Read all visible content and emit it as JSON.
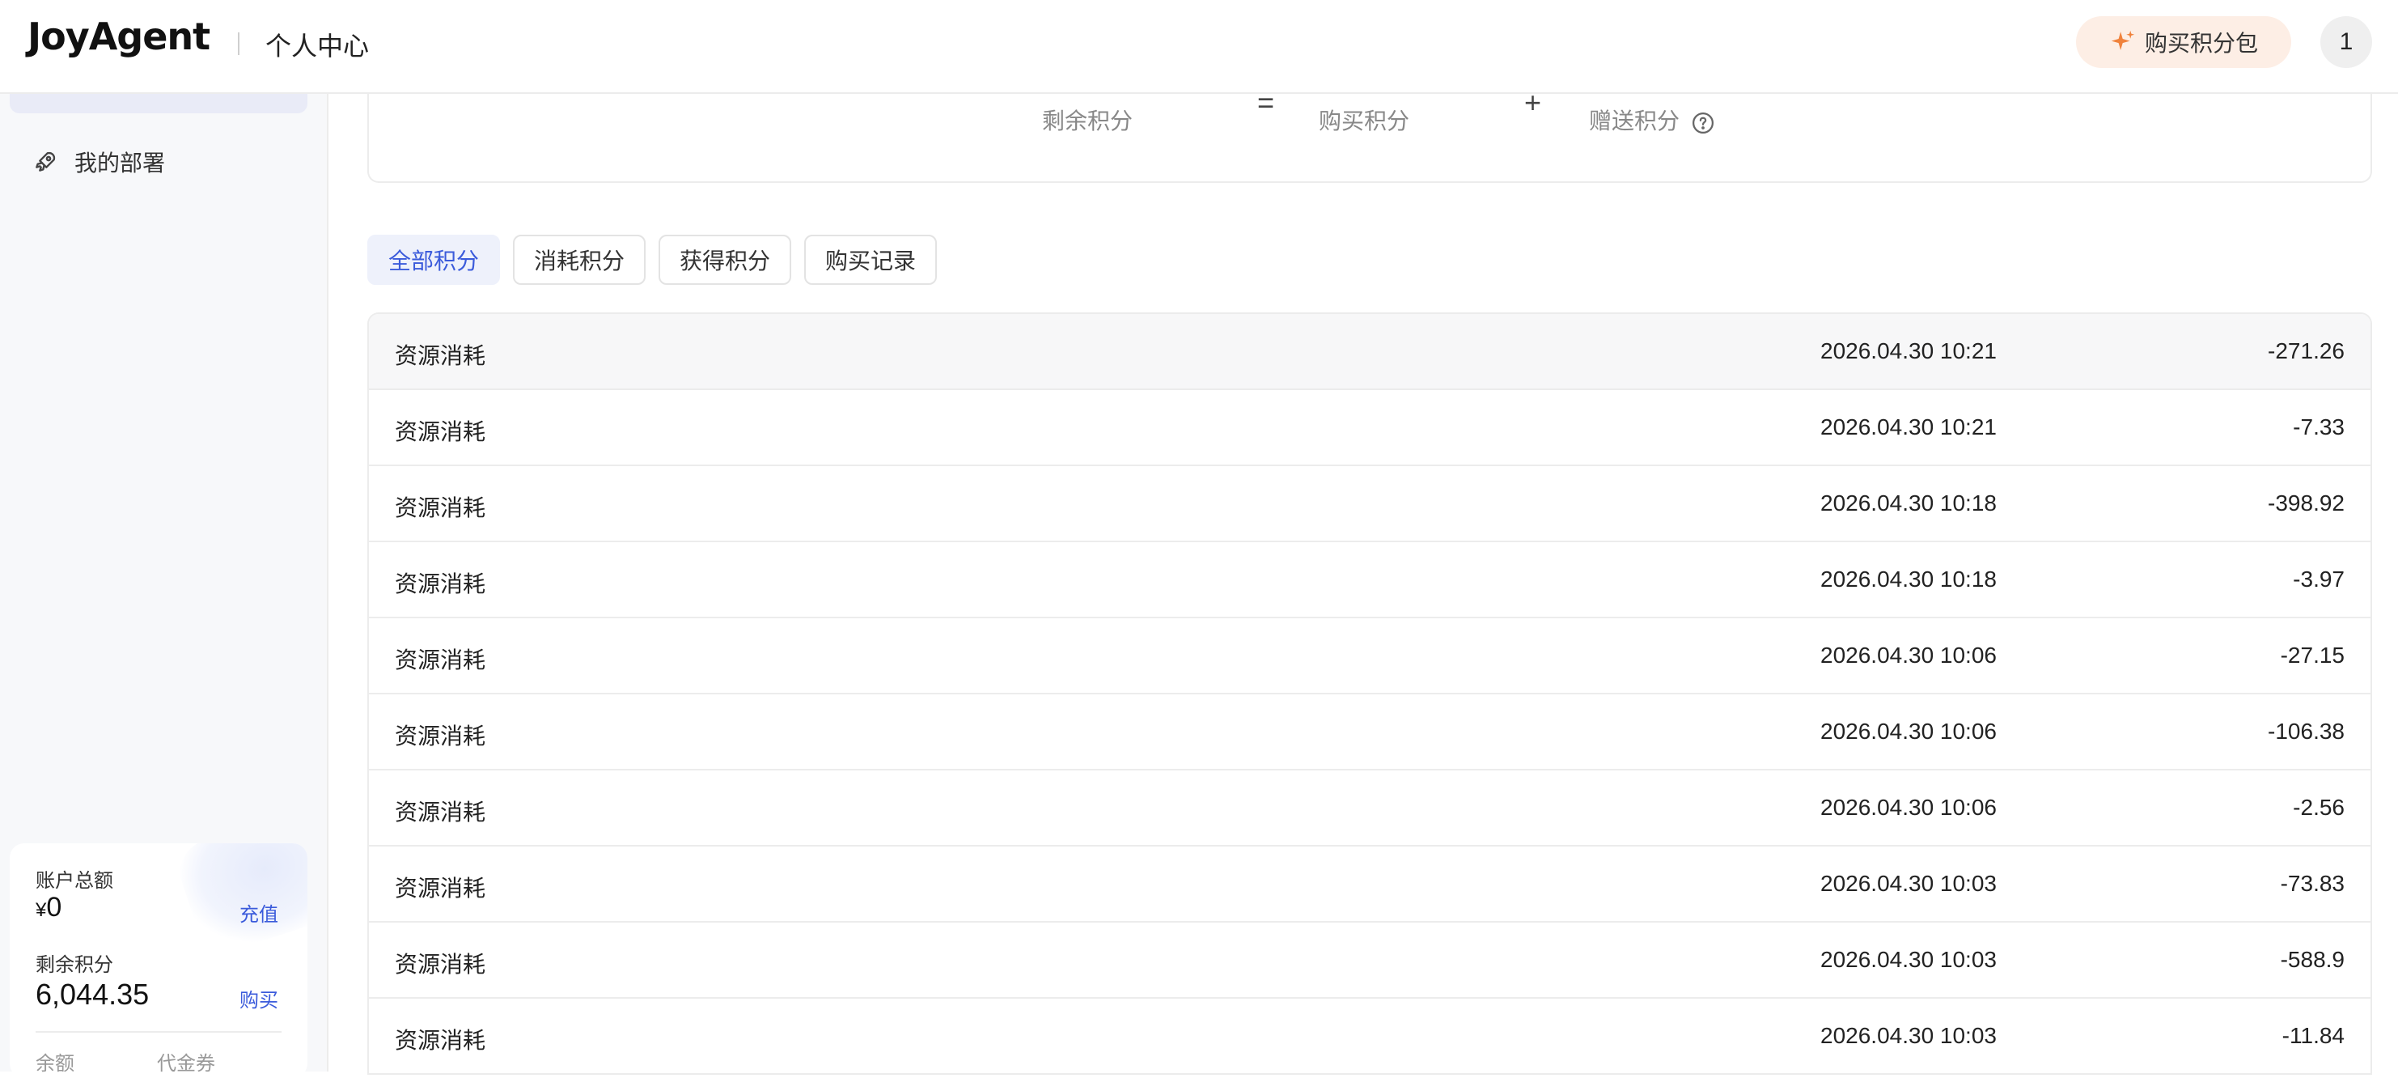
{
  "header": {
    "logo": "JoyAgent",
    "section_title": "个人中心",
    "buy_pack_label": "购买积分包",
    "avatar_text": "1"
  },
  "sidebar": {
    "items": [
      {
        "label": "我的部署",
        "icon": "rocket-icon"
      }
    ],
    "account": {
      "total_label": "账户总额",
      "currency": "¥",
      "total_value": "0",
      "recharge_label": "充值",
      "points_label": "剩余积分",
      "points_value": "6,044.35",
      "buy_label": "购买",
      "balance_label": "余额",
      "voucher_label": "代金券"
    }
  },
  "summary": {
    "remaining_label": "剩余积分",
    "equals": "=",
    "purchased_label": "购买积分",
    "plus": "+",
    "gifted_label": "赠送积分"
  },
  "tabs": [
    {
      "label": "全部积分",
      "active": true
    },
    {
      "label": "消耗积分",
      "active": false
    },
    {
      "label": "获得积分",
      "active": false
    },
    {
      "label": "购买记录",
      "active": false
    }
  ],
  "records": [
    {
      "type": "资源消耗",
      "time": "2026.04.30 10:21",
      "amount": "-271.26"
    },
    {
      "type": "资源消耗",
      "time": "2026.04.30 10:21",
      "amount": "-7.33"
    },
    {
      "type": "资源消耗",
      "time": "2026.04.30 10:18",
      "amount": "-398.92"
    },
    {
      "type": "资源消耗",
      "time": "2026.04.30 10:18",
      "amount": "-3.97"
    },
    {
      "type": "资源消耗",
      "time": "2026.04.30 10:06",
      "amount": "-27.15"
    },
    {
      "type": "资源消耗",
      "time": "2026.04.30 10:06",
      "amount": "-106.38"
    },
    {
      "type": "资源消耗",
      "time": "2026.04.30 10:06",
      "amount": "-2.56"
    },
    {
      "type": "资源消耗",
      "time": "2026.04.30 10:03",
      "amount": "-73.83"
    },
    {
      "type": "资源消耗",
      "time": "2026.04.30 10:03",
      "amount": "-588.9"
    },
    {
      "type": "资源消耗",
      "time": "2026.04.30 10:03",
      "amount": "-11.84"
    }
  ],
  "colors": {
    "accent": "#3b5bdb",
    "buy_pack_bg": "#fdeee5",
    "sparkle": "#f0823c"
  }
}
